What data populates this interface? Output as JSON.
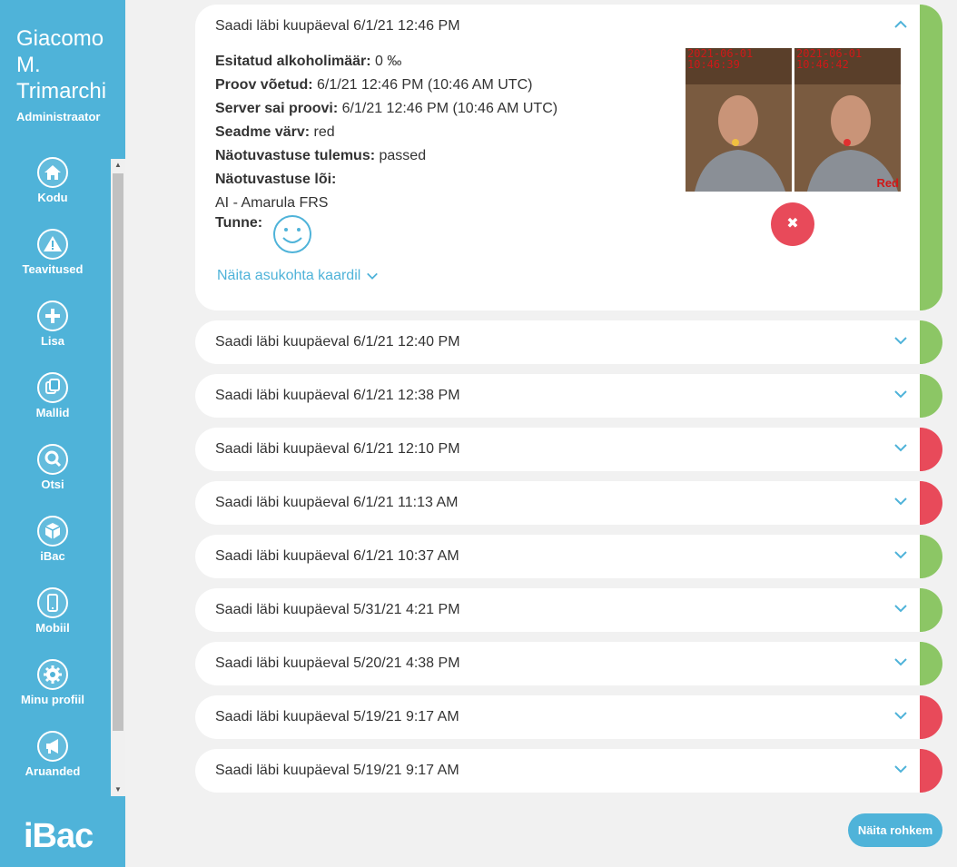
{
  "user": {
    "name": "Giacomo M. Trimarchi",
    "role": "Administraator"
  },
  "nav": [
    {
      "label": "Kodu",
      "icon": "home-icon"
    },
    {
      "label": "Teavitused",
      "icon": "warning-icon"
    },
    {
      "label": "Lisa",
      "icon": "plus-icon"
    },
    {
      "label": "Mallid",
      "icon": "templates-icon"
    },
    {
      "label": "Otsi",
      "icon": "search-icon"
    },
    {
      "label": "iBac",
      "icon": "cube-icon"
    },
    {
      "label": "Mobiil",
      "icon": "mobile-icon"
    },
    {
      "label": "Minu profiil",
      "icon": "gear-icon"
    },
    {
      "label": "Aruanded",
      "icon": "megaphone-icon"
    }
  ],
  "logo": "iBac",
  "colors": {
    "accent": "#4fb3d9",
    "pass": "#8cc665",
    "fail": "#e84a5a"
  },
  "expanded": {
    "title": "Saadi läbi kuupäeval 6/1/21 12:46 PM",
    "status": "pass",
    "fields": [
      {
        "label": "Esitatud alkoholimäär:",
        "value": "0 ‰"
      },
      {
        "label": "Proov võetud:",
        "value": "6/1/21 12:46 PM (10:46 AM UTC)"
      },
      {
        "label": "Server sai proovi:",
        "value": "6/1/21 12:46 PM (10:46 AM UTC)"
      },
      {
        "label": "Seadme värv:",
        "value": "red"
      },
      {
        "label": "Näotuvastuse tulemus:",
        "value": "passed"
      },
      {
        "label": "Näotuvastuse lõi:",
        "value": ""
      }
    ],
    "recognizer": "AI - Amarula FRS",
    "feeling_label": "Tunne:",
    "map_link": "Näita asukohta kaardil",
    "photos": [
      {
        "date": "2021-06-01",
        "time": "10:46:39",
        "tag": ""
      },
      {
        "date": "2021-06-01",
        "time": "10:46:42",
        "tag": "Red"
      }
    ]
  },
  "tests": [
    {
      "title": "Saadi läbi kuupäeval 6/1/21 12:40 PM",
      "status": "pass"
    },
    {
      "title": "Saadi läbi kuupäeval 6/1/21 12:38 PM",
      "status": "pass"
    },
    {
      "title": "Saadi läbi kuupäeval 6/1/21 12:10 PM",
      "status": "fail"
    },
    {
      "title": "Saadi läbi kuupäeval 6/1/21 11:13 AM",
      "status": "fail"
    },
    {
      "title": "Saadi läbi kuupäeval 6/1/21 10:37 AM",
      "status": "pass"
    },
    {
      "title": "Saadi läbi kuupäeval 5/31/21 4:21 PM",
      "status": "pass"
    },
    {
      "title": "Saadi läbi kuupäeval 5/20/21 4:38 PM",
      "status": "pass"
    },
    {
      "title": "Saadi läbi kuupäeval 5/19/21 9:17 AM",
      "status": "fail"
    },
    {
      "title": "Saadi läbi kuupäeval 5/19/21 9:17 AM",
      "status": "fail"
    }
  ],
  "show_more": "Näita rohkem"
}
